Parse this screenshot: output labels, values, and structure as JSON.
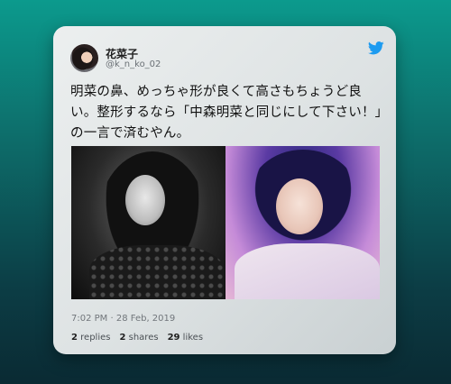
{
  "tweet": {
    "display_name": "花菜子",
    "handle": "@k_n_ko_02",
    "text": "明菜の鼻、めっちゃ形が良くて高さもちょうど良い。整形するなら「中森明菜と同じにして下さい！」の一言で済むやん。",
    "timestamp": "7:02 PM · 28 Feb, 2019",
    "stats": {
      "replies_count": "2",
      "replies_label": "replies",
      "shares_count": "2",
      "shares_label": "shares",
      "likes_count": "29",
      "likes_label": "likes"
    }
  },
  "icons": {
    "brand": "twitter-bird-icon"
  },
  "colors": {
    "twitter_blue": "#1d9bf0",
    "background_top": "#0c9a8d",
    "background_bottom": "#0a2a33",
    "card": "#e3e7e8"
  }
}
